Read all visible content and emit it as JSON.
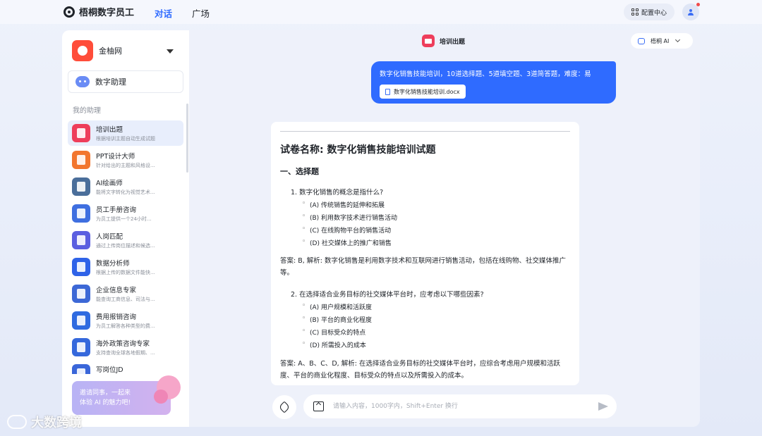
{
  "app": {
    "name": "梧桐数字员工"
  },
  "nav": {
    "items": [
      {
        "label": "对话",
        "active": true
      },
      {
        "label": "广场",
        "active": false
      }
    ]
  },
  "header": {
    "config_label": "配置中心"
  },
  "sidebar": {
    "org_name": "金柚网",
    "helper_label": "数字助理",
    "section_title": "我的助理",
    "items": [
      {
        "name": "培训出题",
        "desc": "根据培训主题自动生成试题",
        "color": "#ee3e5b",
        "icon": "exam-icon",
        "active": true
      },
      {
        "name": "PPT设计大师",
        "desc": "针对给出的主题和风格设...",
        "color": "#f2762e",
        "icon": "ppt-icon"
      },
      {
        "name": "AI绘画师",
        "desc": "能将文字转化为视觉艺术...",
        "color": "#4a6e9a",
        "icon": "portrait-icon"
      },
      {
        "name": "员工手册咨询",
        "desc": "为员工提供一个24小时...",
        "color": "#3f6fe0",
        "icon": "book-icon"
      },
      {
        "name": "人岗匹配",
        "desc": "通过上传岗位描述和候选...",
        "color": "#5b5fe0",
        "icon": "cv-icon"
      },
      {
        "name": "数据分析师",
        "desc": "根据上传的数据文件能快...",
        "color": "#2f63e8",
        "icon": "chart-icon"
      },
      {
        "name": "企业信息专家",
        "desc": "能查询工商信息、司法与...",
        "color": "#3d68d6",
        "icon": "enterprise-icon"
      },
      {
        "name": "费用报销咨询",
        "desc": "为员工解答各种类型的费...",
        "color": "#2f6be0",
        "icon": "receipt-icon"
      },
      {
        "name": "海外政策咨询专家",
        "desc": "支持查询全球各地假期、...",
        "color": "#3568dc",
        "icon": "globe-icon"
      },
      {
        "name": "写岗位JD",
        "desc": "",
        "color": "#3a66d9",
        "icon": "jd-icon"
      }
    ],
    "invite": {
      "line1": "邀请同事，一起来",
      "line2": "体验 AI 的魅力吧!"
    }
  },
  "chat": {
    "title": "培训出题",
    "model": "梧桐 AI",
    "user_message": "数字化销售技能培训，10道选择题、5道填空题、3道简答题，难度：易",
    "attachment": "数字化销售技能培训.docx",
    "answer": {
      "paper_title": "试卷名称: 数字化销售技能培训试题",
      "section": "一、选择题",
      "questions": [
        {
          "q": "1. 数字化销售的概念是指什么?",
          "options": [
            "(A) 传统销售的延伸和拓展",
            "(B) 利用数字技术进行销售活动",
            "(C) 在线购物平台的销售活动",
            "(D) 社交媒体上的推广和销售"
          ],
          "answer": "答案: B,  解析: 数字化销售是利用数字技术和互联网进行销售活动，包括在线购物、社交媒体推广等。"
        },
        {
          "q": "2. 在选择适合业务目标的社交媒体平台时，应考虑以下哪些因素?",
          "options": [
            "(A) 用户规模和活跃度",
            "(B) 平台的商业化程度",
            "(C) 目标受众的特点",
            "(D) 所需投入的成本"
          ],
          "answer": "答案: A、B、C、D,  解析: 在选择适合业务目标的社交媒体平台时，应综合考虑用户规模和活跃度、平台的商业化程度、目标受众的特点以及所需投入的成本。"
        }
      ]
    },
    "input_placeholder": "请输入内容，1000字内，Shift+Enter 换行"
  },
  "watermark": {
    "text": "大数跨境"
  },
  "colors": {
    "accent": "#2f6bff",
    "background": "#eef2fb"
  }
}
